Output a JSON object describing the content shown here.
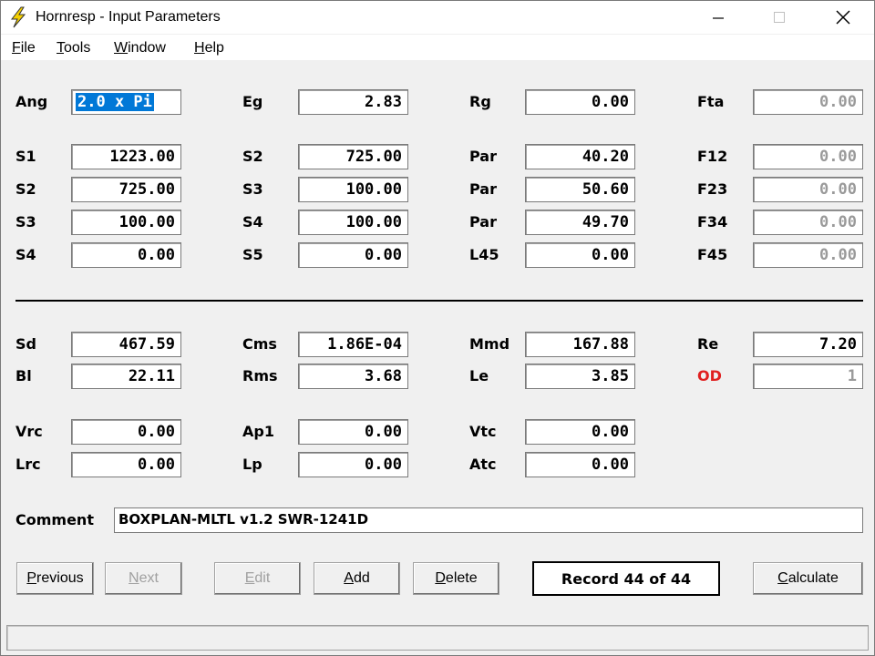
{
  "window": {
    "title": "Hornresp - Input Parameters",
    "controls": {
      "minimize": "—",
      "maximize": "☐",
      "close": "✕"
    }
  },
  "menu": [
    {
      "underline": "F",
      "rest": "ile"
    },
    {
      "underline": "T",
      "rest": "ools"
    },
    {
      "underline": "W",
      "rest": "indow"
    },
    {
      "underline": "H",
      "rest": "elp"
    }
  ],
  "params": {
    "ang": {
      "label": "Ang",
      "value": "2.0 x Pi"
    },
    "eg": {
      "label": "Eg",
      "value": "2.83"
    },
    "rg": {
      "label": "Rg",
      "value": "0.00"
    },
    "fta": {
      "label": "Fta",
      "value": "0.00"
    },
    "row1": {
      "c1": {
        "label": "S1",
        "value": "1223.00"
      },
      "c2": {
        "label": "S2",
        "value": "725.00"
      },
      "c3": {
        "label": "Par",
        "value": "40.20"
      },
      "c4": {
        "label": "F12",
        "value": "0.00"
      }
    },
    "row2": {
      "c1": {
        "label": "S2",
        "value": "725.00"
      },
      "c2": {
        "label": "S3",
        "value": "100.00"
      },
      "c3": {
        "label": "Par",
        "value": "50.60"
      },
      "c4": {
        "label": "F23",
        "value": "0.00"
      }
    },
    "row3": {
      "c1": {
        "label": "S3",
        "value": "100.00"
      },
      "c2": {
        "label": "S4",
        "value": "100.00"
      },
      "c3": {
        "label": "Par",
        "value": "49.70"
      },
      "c4": {
        "label": "F34",
        "value": "0.00"
      }
    },
    "row4": {
      "c1": {
        "label": "S4",
        "value": "0.00"
      },
      "c2": {
        "label": "S5",
        "value": "0.00"
      },
      "c3": {
        "label": "L45",
        "value": "0.00"
      },
      "c4": {
        "label": "F45",
        "value": "0.00"
      }
    },
    "sd": {
      "label": "Sd",
      "value": "467.59"
    },
    "cms": {
      "label": "Cms",
      "value": "1.86E-04"
    },
    "mmd": {
      "label": "Mmd",
      "value": "167.88"
    },
    "re": {
      "label": "Re",
      "value": "7.20"
    },
    "bl": {
      "label": "Bl",
      "value": "22.11"
    },
    "rms": {
      "label": "Rms",
      "value": "3.68"
    },
    "le": {
      "label": "Le",
      "value": "3.85"
    },
    "od": {
      "label": "OD",
      "value": "1"
    },
    "vrc": {
      "label": "Vrc",
      "value": "0.00"
    },
    "ap1": {
      "label": "Ap1",
      "value": "0.00"
    },
    "vtc": {
      "label": "Vtc",
      "value": "0.00"
    },
    "lrc": {
      "label": "Lrc",
      "value": "0.00"
    },
    "lp": {
      "label": "Lp",
      "value": "0.00"
    },
    "atc": {
      "label": "Atc",
      "value": "0.00"
    }
  },
  "comment": {
    "label": "Comment",
    "value": "BOXPLAN-MLTL v1.2 SWR-1241D"
  },
  "buttons": {
    "previous": {
      "u": "P",
      "rest": "revious"
    },
    "next": {
      "u": "N",
      "rest": "ext"
    },
    "edit": {
      "u": "E",
      "rest": "dit"
    },
    "add": {
      "u": "A",
      "rest": "dd"
    },
    "delete": {
      "u": "D",
      "rest": "elete"
    },
    "calculate": {
      "u": "C",
      "rest": "alculate"
    }
  },
  "record": "Record 44 of 44",
  "colors": {
    "od_label": "#e02020",
    "selection": "#0078d7",
    "icon": "#f5d000"
  }
}
